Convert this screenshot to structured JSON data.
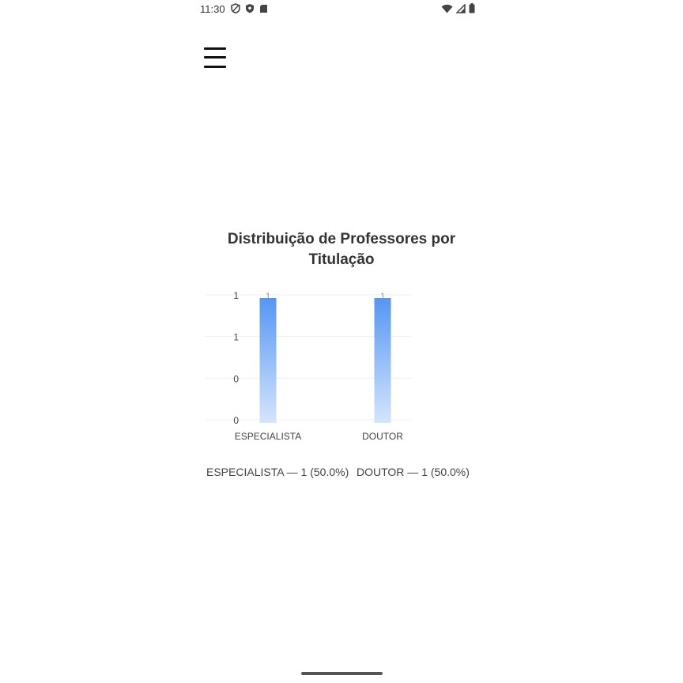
{
  "status_bar": {
    "time": "11:30",
    "icons_left": [
      "shield-outline-icon",
      "security-shield-icon",
      "sd-card-icon"
    ],
    "icons_right": [
      "wifi-icon",
      "cellular-signal-icon",
      "battery-icon"
    ]
  },
  "header": {
    "menu_icon": "hamburger-menu-icon"
  },
  "chart_data": {
    "type": "bar",
    "title": "Distribuição de Professores por Titulação",
    "categories": [
      "ESPECIALISTA",
      "DOUTOR"
    ],
    "values": [
      1,
      1
    ],
    "data_labels": [
      "1",
      "1"
    ],
    "y_tick_labels": [
      "1",
      "1",
      "0",
      "0"
    ],
    "ylim": [
      0,
      1
    ],
    "grid": true,
    "bar_color_top": "#5596f4",
    "bar_color_bottom": "#d4e5fd",
    "legend": [
      {
        "label": "ESPECIALISTA — 1 (50.0%)"
      },
      {
        "label": "DOUTOR — 1 (50.0%)"
      }
    ]
  }
}
